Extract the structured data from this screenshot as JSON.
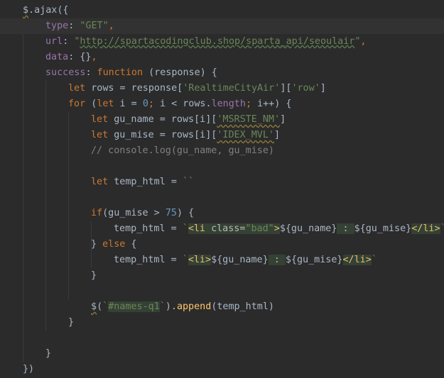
{
  "editor": {
    "lines": [
      {
        "indent": 0,
        "caret": false,
        "parts": [
          {
            "t": "$",
            "c": "plain tilde"
          },
          {
            "t": ".ajax({",
            "c": "plain"
          }
        ]
      },
      {
        "indent": 1,
        "caret": true,
        "parts": [
          {
            "t": "type",
            "c": "prop"
          },
          {
            "t": ": ",
            "c": "plain"
          },
          {
            "t": "\"GET\"",
            "c": "str"
          },
          {
            "t": ",",
            "c": "kw"
          }
        ]
      },
      {
        "indent": 1,
        "caret": false,
        "parts": [
          {
            "t": "url",
            "c": "prop"
          },
          {
            "t": ": ",
            "c": "plain"
          },
          {
            "t": "\"",
            "c": "str"
          },
          {
            "t": "http://spartacodingclub.shop/sparta_api/seoulair",
            "c": "url"
          },
          {
            "t": "\"",
            "c": "str"
          },
          {
            "t": ",",
            "c": "kw"
          }
        ]
      },
      {
        "indent": 1,
        "caret": false,
        "parts": [
          {
            "t": "data",
            "c": "prop"
          },
          {
            "t": ": {}",
            "c": "plain"
          },
          {
            "t": ",",
            "c": "kw"
          }
        ]
      },
      {
        "indent": 1,
        "caret": false,
        "parts": [
          {
            "t": "success",
            "c": "prop"
          },
          {
            "t": ": ",
            "c": "plain"
          },
          {
            "t": "function",
            "c": "kw"
          },
          {
            "t": " (response) {",
            "c": "plain"
          }
        ]
      },
      {
        "indent": 2,
        "caret": false,
        "parts": [
          {
            "t": "let",
            "c": "kw"
          },
          {
            "t": " rows = response[",
            "c": "plain"
          },
          {
            "t": "'RealtimeCityAir'",
            "c": "str"
          },
          {
            "t": "][",
            "c": "plain"
          },
          {
            "t": "'row'",
            "c": "str"
          },
          {
            "t": "]",
            "c": "plain"
          }
        ]
      },
      {
        "indent": 2,
        "caret": false,
        "parts": [
          {
            "t": "for",
            "c": "kw"
          },
          {
            "t": " (",
            "c": "plain"
          },
          {
            "t": "let",
            "c": "kw"
          },
          {
            "t": " i = ",
            "c": "plain"
          },
          {
            "t": "0",
            "c": "num"
          },
          {
            "t": "; ",
            "c": "kw"
          },
          {
            "t": "i < rows.",
            "c": "plain"
          },
          {
            "t": "length",
            "c": "prop"
          },
          {
            "t": "; ",
            "c": "kw"
          },
          {
            "t": "i++) {",
            "c": "plain"
          }
        ]
      },
      {
        "indent": 3,
        "caret": false,
        "parts": [
          {
            "t": "let",
            "c": "kw"
          },
          {
            "t": " gu_name = rows[i][",
            "c": "plain"
          },
          {
            "t": "'MSRSTE_NM'",
            "c": "str tilde"
          },
          {
            "t": "]",
            "c": "plain"
          }
        ]
      },
      {
        "indent": 3,
        "caret": false,
        "parts": [
          {
            "t": "let",
            "c": "kw"
          },
          {
            "t": " gu_mise = rows[i][",
            "c": "plain"
          },
          {
            "t": "'IDEX_MVL'",
            "c": "str tilde"
          },
          {
            "t": "]",
            "c": "plain"
          }
        ]
      },
      {
        "indent": 3,
        "caret": false,
        "parts": [
          {
            "t": "// console.log(gu_name, gu_mise)",
            "c": "cmt"
          }
        ]
      },
      {
        "indent": 0,
        "caret": false,
        "parts": []
      },
      {
        "indent": 3,
        "caret": false,
        "parts": [
          {
            "t": "let",
            "c": "kw"
          },
          {
            "t": " temp_html = ",
            "c": "plain"
          },
          {
            "t": "``",
            "c": "str"
          }
        ]
      },
      {
        "indent": 0,
        "caret": false,
        "parts": []
      },
      {
        "indent": 3,
        "caret": false,
        "parts": [
          {
            "t": "if",
            "c": "kw"
          },
          {
            "t": "(gu_mise > ",
            "c": "plain"
          },
          {
            "t": "75",
            "c": "num"
          },
          {
            "t": ") {",
            "c": "plain"
          }
        ]
      },
      {
        "indent": 4,
        "caret": false,
        "parts": [
          {
            "t": "temp_html = ",
            "c": "plain"
          },
          {
            "t": "`",
            "c": "tpl"
          },
          {
            "t": "<li ",
            "c": "tag tpl-bg"
          },
          {
            "t": "class=",
            "c": "attr tpl-bg"
          },
          {
            "t": "\"bad\"",
            "c": "str tpl-bg"
          },
          {
            "t": ">",
            "c": "tag tpl-bg"
          },
          {
            "t": "${gu_name}",
            "c": "plain"
          },
          {
            "t": " : ",
            "c": "plain tpl-bg"
          },
          {
            "t": "${gu_mise}",
            "c": "plain"
          },
          {
            "t": "</li>",
            "c": "tag tpl-bg"
          },
          {
            "t": "`",
            "c": "tpl"
          }
        ]
      },
      {
        "indent": 3,
        "caret": false,
        "parts": [
          {
            "t": "} ",
            "c": "plain"
          },
          {
            "t": "else",
            "c": "kw"
          },
          {
            "t": " {",
            "c": "plain"
          }
        ]
      },
      {
        "indent": 4,
        "caret": false,
        "parts": [
          {
            "t": "temp_html = ",
            "c": "plain"
          },
          {
            "t": "`",
            "c": "tpl"
          },
          {
            "t": "<li>",
            "c": "tag tpl-bg"
          },
          {
            "t": "${gu_name}",
            "c": "plain"
          },
          {
            "t": " : ",
            "c": "plain tpl-bg"
          },
          {
            "t": "${gu_mise}",
            "c": "plain"
          },
          {
            "t": "</li>",
            "c": "tag tpl-bg"
          },
          {
            "t": "`",
            "c": "tpl"
          }
        ]
      },
      {
        "indent": 3,
        "caret": false,
        "parts": [
          {
            "t": "}",
            "c": "plain"
          }
        ]
      },
      {
        "indent": 0,
        "caret": false,
        "parts": []
      },
      {
        "indent": 3,
        "caret": false,
        "parts": [
          {
            "t": "$",
            "c": "plain tilde"
          },
          {
            "t": "(",
            "c": "plain"
          },
          {
            "t": "`",
            "c": "str"
          },
          {
            "t": "#names-q1",
            "c": "str tpl-bg"
          },
          {
            "t": "`",
            "c": "str"
          },
          {
            "t": ").",
            "c": "plain"
          },
          {
            "t": "append",
            "c": "fn"
          },
          {
            "t": "(temp_html)",
            "c": "plain"
          }
        ]
      },
      {
        "indent": 2,
        "caret": false,
        "parts": [
          {
            "t": "}",
            "c": "plain"
          }
        ]
      },
      {
        "indent": 0,
        "caret": false,
        "parts": []
      },
      {
        "indent": 1,
        "caret": false,
        "parts": [
          {
            "t": "}",
            "c": "plain"
          }
        ]
      },
      {
        "indent": 0,
        "caret": false,
        "parts": [
          {
            "t": "})",
            "c": "plain"
          }
        ]
      }
    ]
  }
}
